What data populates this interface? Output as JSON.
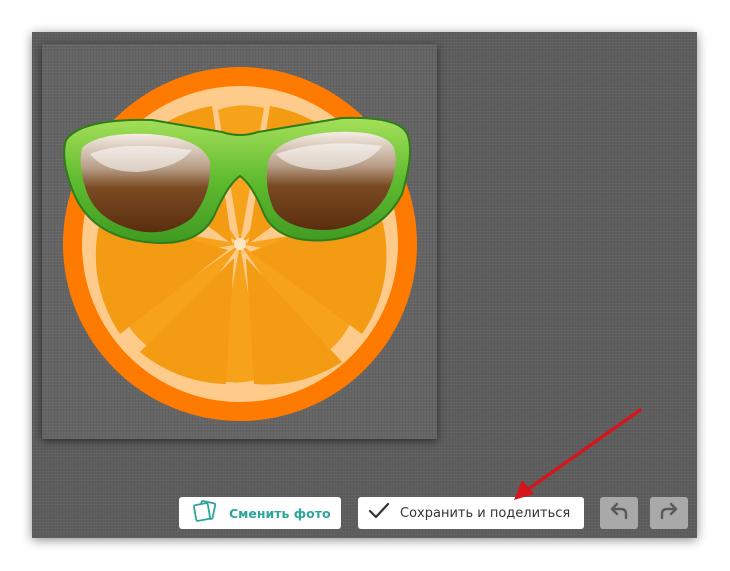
{
  "editor": {
    "image_subject": "orange-slice-with-sunglasses",
    "toolbar": {
      "change_photo_label": "Сменить фото",
      "save_share_label": "Сохранить и поделиться",
      "undo_icon": "undo-icon",
      "redo_icon": "redo-icon"
    }
  },
  "colors": {
    "accent_teal": "#2ca69a",
    "annotation_red": "#d4161c",
    "editor_bg": "#5d5d5d",
    "orange": "#ff7b00",
    "orange_segment": "#f7a21b",
    "sunglasses_frame": "#6cc13a"
  }
}
